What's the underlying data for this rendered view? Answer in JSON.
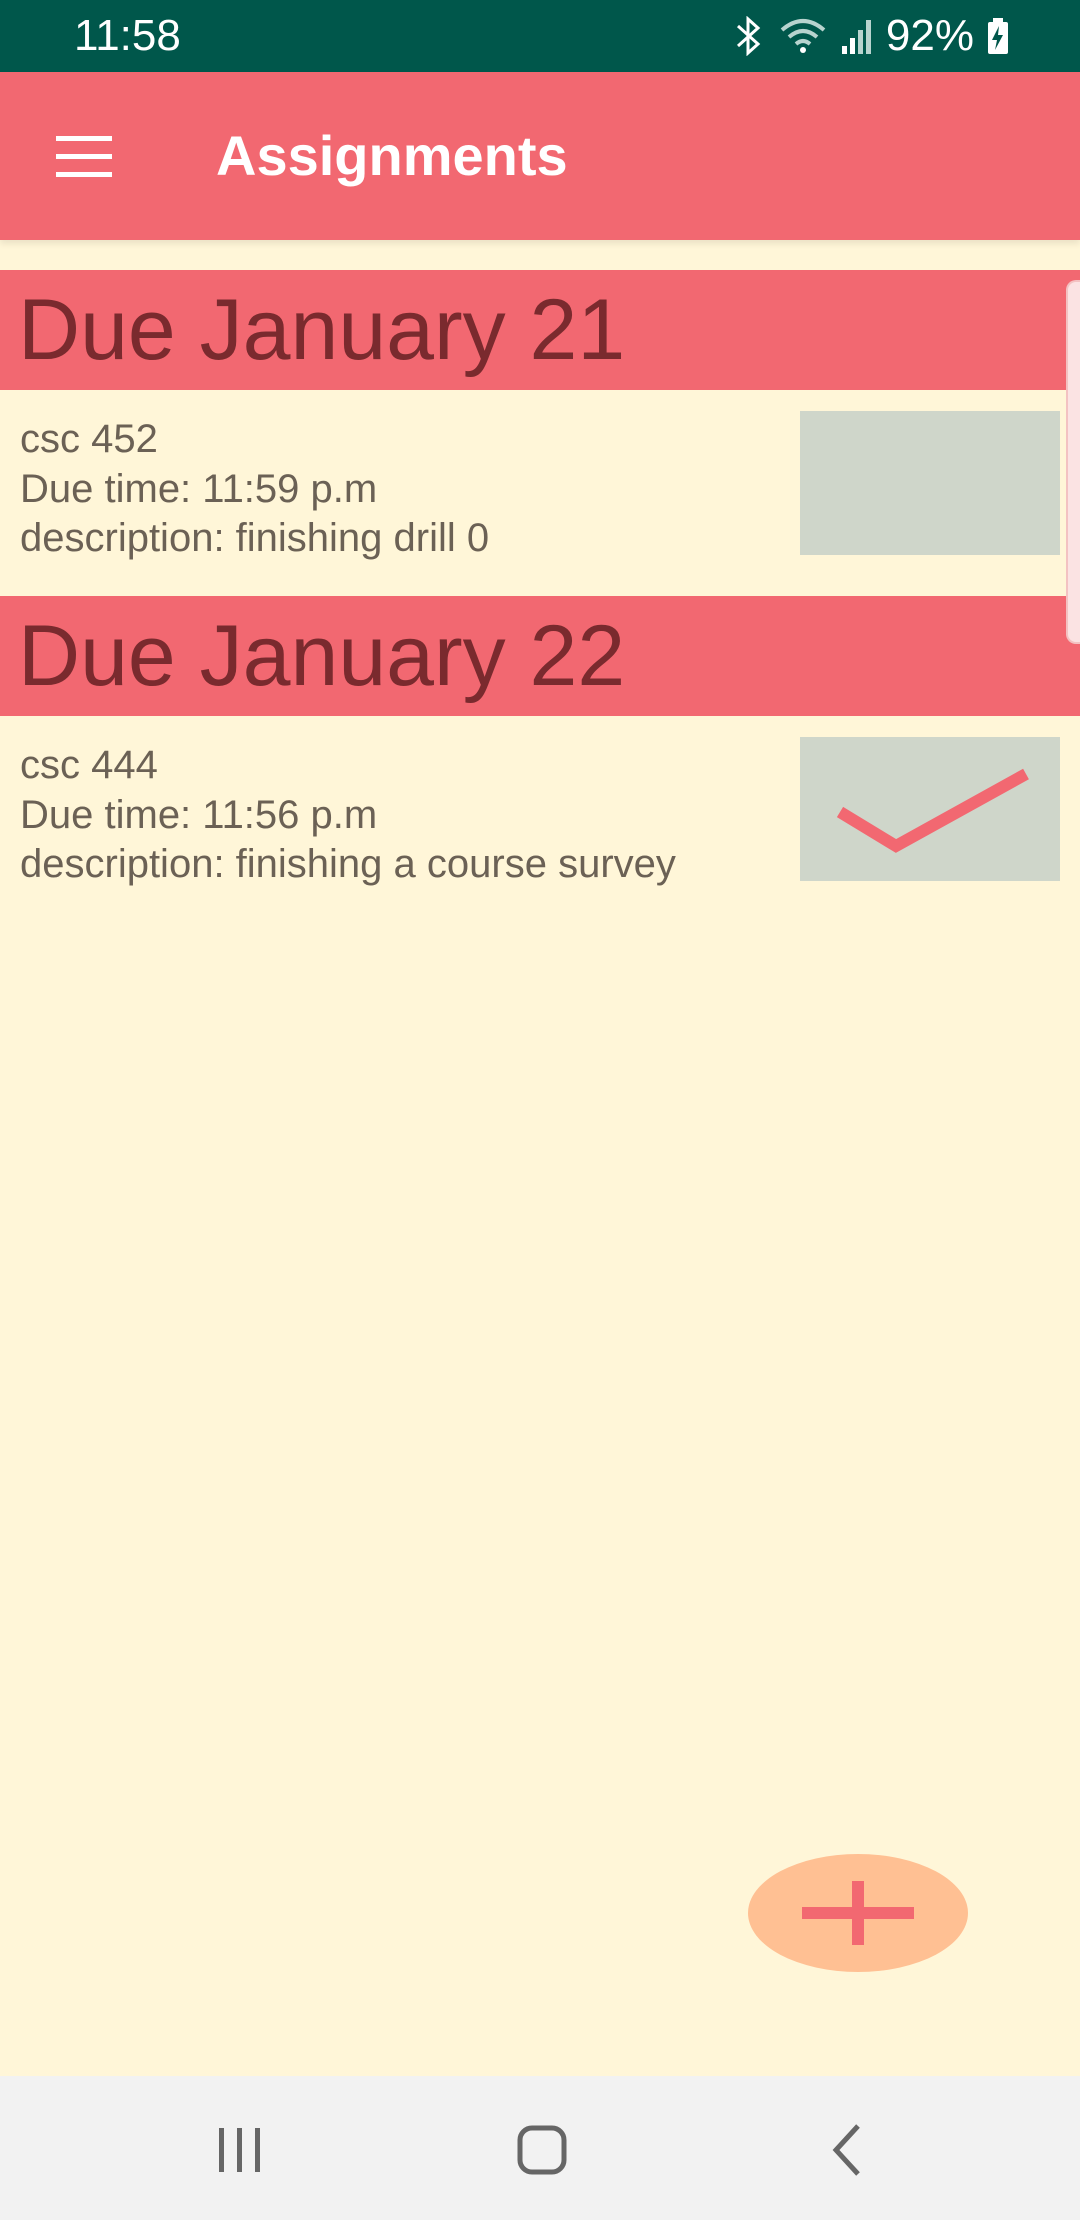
{
  "status_bar": {
    "time": "11:58",
    "battery_percent": "92%",
    "icons": [
      "bluetooth-icon",
      "wifi-icon",
      "signal-icon",
      "battery-charging-icon"
    ]
  },
  "app_bar": {
    "title": "Assignments",
    "menu_icon": "hamburger-menu-icon"
  },
  "sections": [
    {
      "header": "Due January 21",
      "items": [
        {
          "course": "csc 452",
          "due_time": "Due time: 11:59 p.m",
          "description": "description: finishing drill 0",
          "completed": false
        }
      ]
    },
    {
      "header": "Due January 22",
      "items": [
        {
          "course": "csc 444",
          "due_time": "Due time: 11:56 p.m",
          "description": "description: finishing a course survey",
          "completed": true
        }
      ]
    }
  ],
  "fab": {
    "icon": "plus-icon"
  },
  "nav_bar": {
    "icons": [
      "recent-apps-icon",
      "home-icon",
      "back-icon"
    ]
  },
  "colors": {
    "status_bar": "#00574b",
    "primary": "#f26871",
    "background": "#fff6d8",
    "header_text": "#7a2a2e",
    "item_text": "#6b6155",
    "checkbox": "#cfd6ca",
    "fab": "#ffc093"
  }
}
